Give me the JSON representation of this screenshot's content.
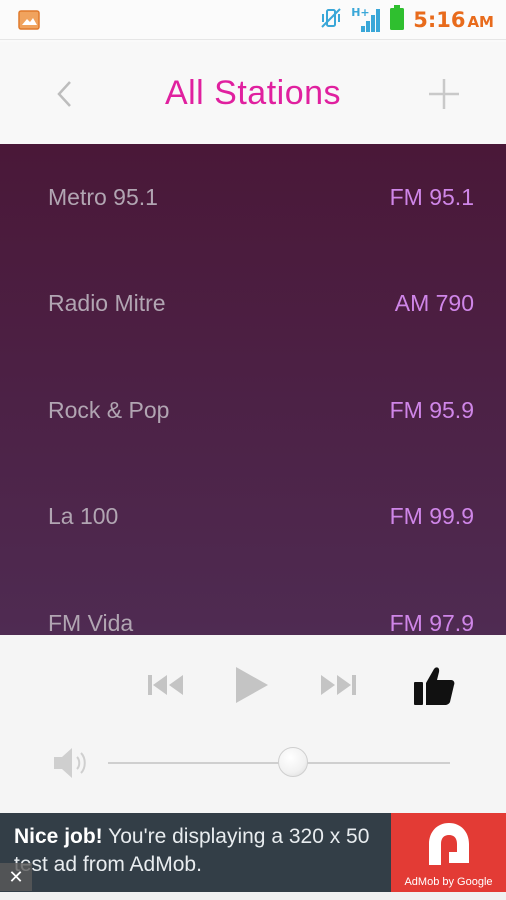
{
  "status_bar": {
    "time": "5:16",
    "ampm": "AM",
    "network_label": "H+",
    "icons": [
      "gallery-notification-icon",
      "vibrate-icon",
      "signal-icon",
      "battery-icon"
    ]
  },
  "header": {
    "title": "All Stations",
    "back_icon": "chevron-left-icon",
    "add_icon": "plus-icon"
  },
  "stations": [
    {
      "name": "Metro 95.1",
      "frequency": "FM 95.1"
    },
    {
      "name": "Radio Mitre",
      "frequency": "AM 790"
    },
    {
      "name": "Rock & Pop",
      "frequency": "FM 95.9"
    },
    {
      "name": "La 100",
      "frequency": "FM 99.9"
    },
    {
      "name": "FM Vida",
      "frequency": "FM 97.9"
    }
  ],
  "player": {
    "controls": [
      "previous-icon",
      "play-icon",
      "next-icon",
      "thumbs-up-icon"
    ],
    "volume_level": 0.54
  },
  "ad": {
    "headline": "Nice job!",
    "body": " You're displaying a 320 x 50 test ad from AdMob.",
    "brand": "AdMob by Google",
    "close_label": "✕"
  },
  "colors": {
    "title": "#e0209f",
    "clock": "#e86b1c",
    "frequency": "#cf86e8",
    "station_name": "#b1a5b2",
    "list_bg_top": "#4a1838",
    "list_bg_bottom": "#4f2b52",
    "ad_bg": "#333e47",
    "ad_logo_bg": "#e33b35"
  }
}
